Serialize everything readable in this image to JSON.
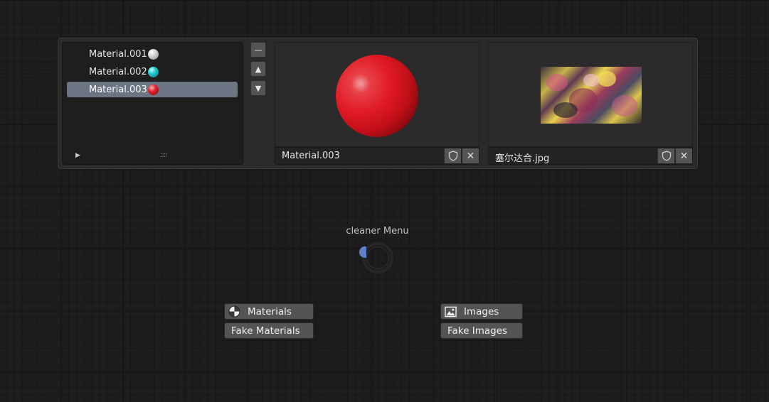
{
  "material_list": {
    "items": [
      {
        "label": "Material.001",
        "icon": "material-white-sphere-icon",
        "selected": false
      },
      {
        "label": "Material.002",
        "icon": "material-cyan-sphere-icon",
        "selected": false
      },
      {
        "label": "Material.003",
        "icon": "material-red-sphere-icon",
        "selected": true
      }
    ],
    "expander_glyph": "▶",
    "grip_glyph": "::::"
  },
  "list_buttons": {
    "remove_glyph": "—",
    "up_glyph": "▲",
    "down_glyph": "▼"
  },
  "material_preview": {
    "name": "Material.003",
    "fake_user_icon": "shield-icon",
    "unlink_glyph": "✕"
  },
  "image_preview": {
    "name": "塞尔达合.jpg",
    "fake_user_icon": "shield-icon",
    "unlink_glyph": "✕"
  },
  "pie_menu": {
    "title": "cleaner Menu",
    "accent_color": "#5f7fc7",
    "left_buttons": [
      {
        "label": "Materials",
        "icon": "material-icon"
      },
      {
        "label": "Fake Materials"
      }
    ],
    "right_buttons": [
      {
        "label": "Images",
        "icon": "image-icon"
      },
      {
        "label": "Fake Images"
      }
    ]
  }
}
